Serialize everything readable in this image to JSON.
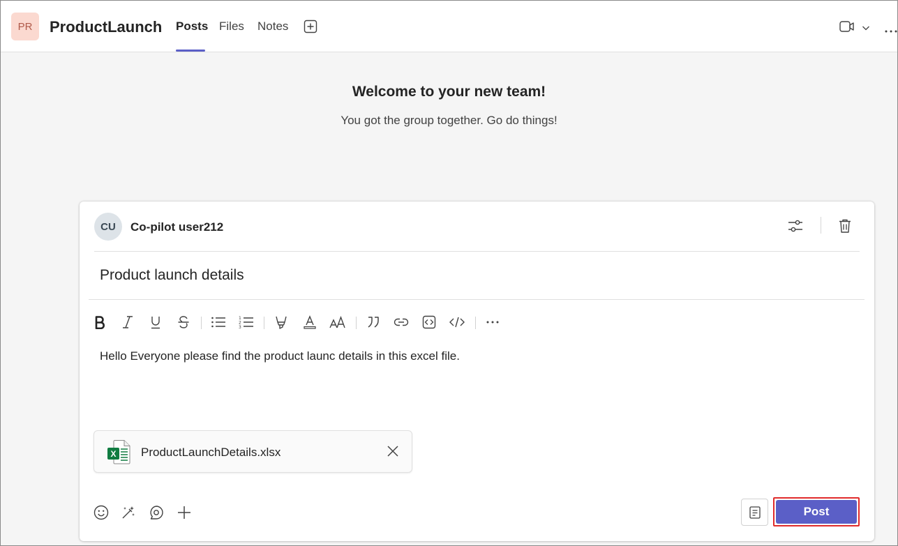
{
  "header": {
    "team_initials": "PR",
    "team_name": "ProductLaunch",
    "tabs": [
      {
        "label": "Posts",
        "active": true
      },
      {
        "label": "Files",
        "active": false
      },
      {
        "label": "Notes",
        "active": false
      }
    ],
    "icons": [
      "add-tab-icon",
      "video-icon",
      "chevron-down-icon",
      "more-icon"
    ]
  },
  "welcome": {
    "title": "Welcome to your new team!",
    "subtitle": "You got the group together. Go do things!"
  },
  "compose": {
    "author_initials": "CU",
    "author_name": "Co-pilot user212",
    "subject": "Product launch details",
    "toolbar_icons": [
      "bold-icon",
      "italic-icon",
      "underline-icon",
      "strikethrough-icon",
      "bullet-list-icon",
      "numbered-list-icon",
      "highlight-icon",
      "font-color-icon",
      "font-size-icon",
      "quote-icon",
      "link-icon",
      "code-snippet-icon",
      "code-icon",
      "more-options-icon"
    ],
    "message": "Hello Everyone please find the product launc details in this excel file.",
    "attachment": {
      "file_name": "ProductLaunchDetails.xlsx",
      "file_type_icon": "excel-icon"
    },
    "bottom_icons": [
      "emoji-icon",
      "copilot-icon",
      "loop-icon",
      "add-icon"
    ],
    "post_label": "Post"
  },
  "colors": {
    "accent": "#5b5fc7",
    "highlight_border": "#e02b2b",
    "excel_green": "#107c41",
    "team_avatar_bg": "#fbd9d0"
  }
}
